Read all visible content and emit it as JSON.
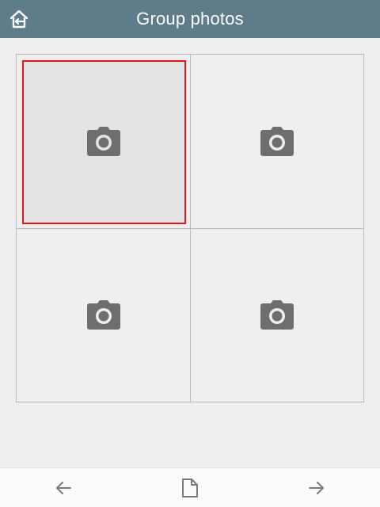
{
  "header": {
    "title": "Group photos",
    "home_icon": "home-back-icon",
    "background": "#5f7c8a"
  },
  "grid": {
    "cells": [
      {
        "icon": "camera-icon",
        "selected": true
      },
      {
        "icon": "camera-icon",
        "selected": false
      },
      {
        "icon": "camera-icon",
        "selected": false
      },
      {
        "icon": "camera-icon",
        "selected": false
      }
    ],
    "selection_color": "#e0161c"
  },
  "bottom_bar": {
    "prev_icon": "arrow-left-icon",
    "doc_icon": "document-icon",
    "next_icon": "arrow-right-icon"
  }
}
